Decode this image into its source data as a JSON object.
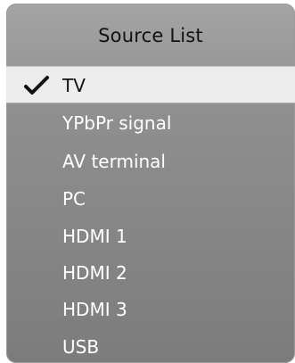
{
  "menu": {
    "title": "Source List",
    "items": [
      {
        "label": "TV",
        "selected": true
      },
      {
        "label": "YPbPr signal",
        "selected": false
      },
      {
        "label": "AV terminal",
        "selected": false
      },
      {
        "label": "PC",
        "selected": false
      },
      {
        "label": "HDMI 1",
        "selected": false
      },
      {
        "label": "HDMI 2",
        "selected": false
      },
      {
        "label": "HDMI 3",
        "selected": false
      },
      {
        "label": "USB",
        "selected": false
      }
    ]
  },
  "icons": {
    "selected_marker": "checkmark-icon"
  },
  "colors": {
    "menu_background": "#8f8f8f",
    "selected_background": "#ececec",
    "item_text": "#ffffff",
    "title_text": "#121212"
  }
}
